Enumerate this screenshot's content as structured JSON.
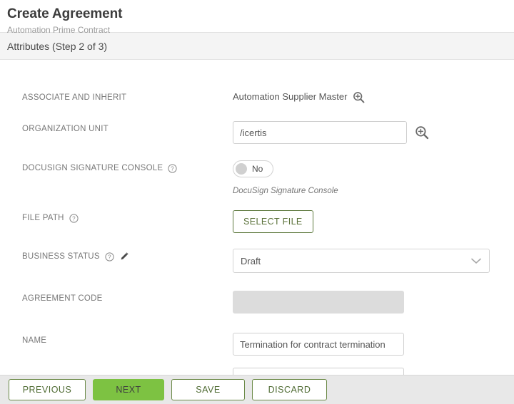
{
  "header": {
    "title": "Create Agreement",
    "subtitle": "Automation Prime Contract"
  },
  "step_bar": {
    "label": "Attributes (Step 2 of 3)"
  },
  "form": {
    "associate_and_inherit": {
      "label": "ASSOCIATE AND INHERIT",
      "value": "Automation Supplier Master",
      "search_icon": "magnifier-plus-icon"
    },
    "organization_unit": {
      "label": "ORGANIZATION UNIT",
      "value": "/icertis",
      "placeholder": "",
      "search_icon": "magnifier-plus-icon"
    },
    "docusign_signature_console": {
      "label": "DOCUSIGN SIGNATURE CONSOLE",
      "help_icon": "help-circle-icon",
      "toggle_value": "No",
      "hint": "DocuSign Signature Console"
    },
    "file_path": {
      "label": "FILE PATH",
      "help_icon": "help-circle-icon",
      "button_label": "SELECT FILE"
    },
    "business_status": {
      "label": "BUSINESS STATUS",
      "help_icon": "help-circle-icon",
      "edit_icon": "pencil-icon",
      "value": "Draft",
      "chevron_icon": "chevron-down-icon"
    },
    "agreement_code": {
      "label": "AGREEMENT CODE",
      "value": "",
      "placeholder": ""
    },
    "name": {
      "label": "NAME",
      "value": "Termination for contract termination",
      "placeholder": ""
    }
  },
  "footer": {
    "previous": "PREVIOUS",
    "next": "NEXT",
    "save": "SAVE",
    "discard": "DISCARD"
  },
  "colors": {
    "primary_green": "#7dc242",
    "outline_green": "#6b8a47",
    "step_bar_bg": "#f4f4f4",
    "footer_bg": "#e8e8e8",
    "disabled_input": "#dcdcdc"
  }
}
